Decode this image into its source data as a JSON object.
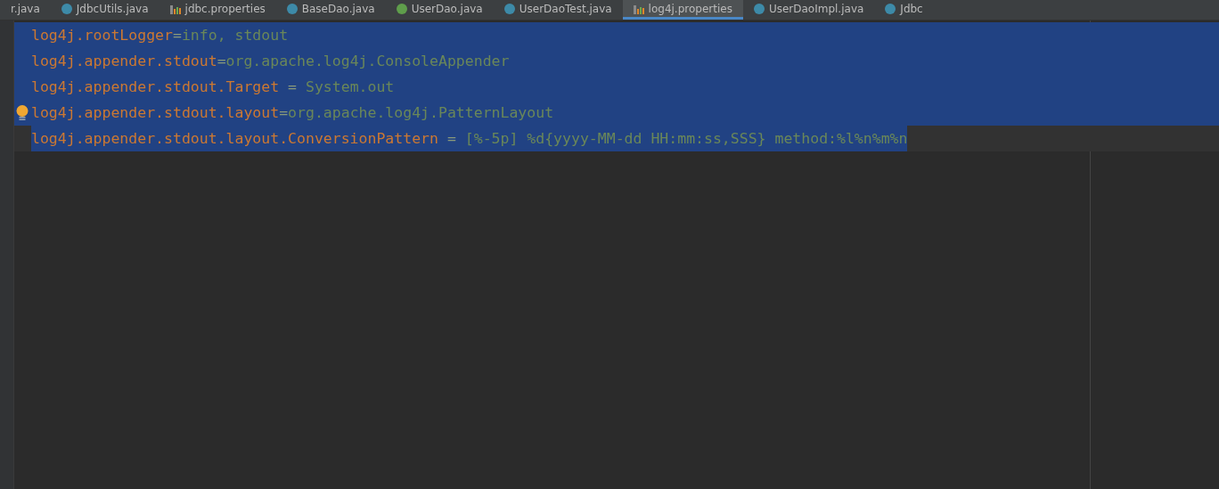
{
  "tabs": [
    {
      "label": "r.java",
      "kind": "none",
      "selected": false
    },
    {
      "label": "JdbcUtils.java",
      "kind": "class",
      "selected": false
    },
    {
      "label": "jdbc.properties",
      "kind": "properties",
      "selected": false
    },
    {
      "label": "BaseDao.java",
      "kind": "class",
      "selected": false
    },
    {
      "label": "UserDao.java",
      "kind": "interface",
      "selected": false
    },
    {
      "label": "UserDaoTest.java",
      "kind": "class",
      "selected": false
    },
    {
      "label": "log4j.properties",
      "kind": "properties",
      "selected": true
    },
    {
      "label": "UserDaoImpl.java",
      "kind": "class",
      "selected": false
    },
    {
      "label": "Jdbc",
      "kind": "class",
      "selected": false
    }
  ],
  "editor": {
    "lines": [
      {
        "key": "log4j.rootLogger",
        "sep": "=",
        "value": "info, stdout",
        "selected": true,
        "current": false,
        "bulb": false
      },
      {
        "key": "log4j.appender.stdout",
        "sep": "=",
        "value": "org.apache.log4j.ConsoleAppender",
        "selected": true,
        "current": false,
        "bulb": false
      },
      {
        "key": "log4j.appender.stdout.Target",
        "sep": " = ",
        "value": "System.out",
        "selected": true,
        "current": false,
        "bulb": false
      },
      {
        "key": "log4j.appender.stdout.layout",
        "sep": "=",
        "value": "org.apache.log4j.PatternLayout",
        "selected": true,
        "current": false,
        "bulb": true
      },
      {
        "key": "log4j.appender.stdout.layout.ConversionPattern",
        "sep": " = ",
        "value": "[%-5p] %d{yyyy-MM-dd HH:mm:ss,SSS} method:%l%n%m%n",
        "selected": true,
        "current": true,
        "bulb": false
      }
    ]
  }
}
